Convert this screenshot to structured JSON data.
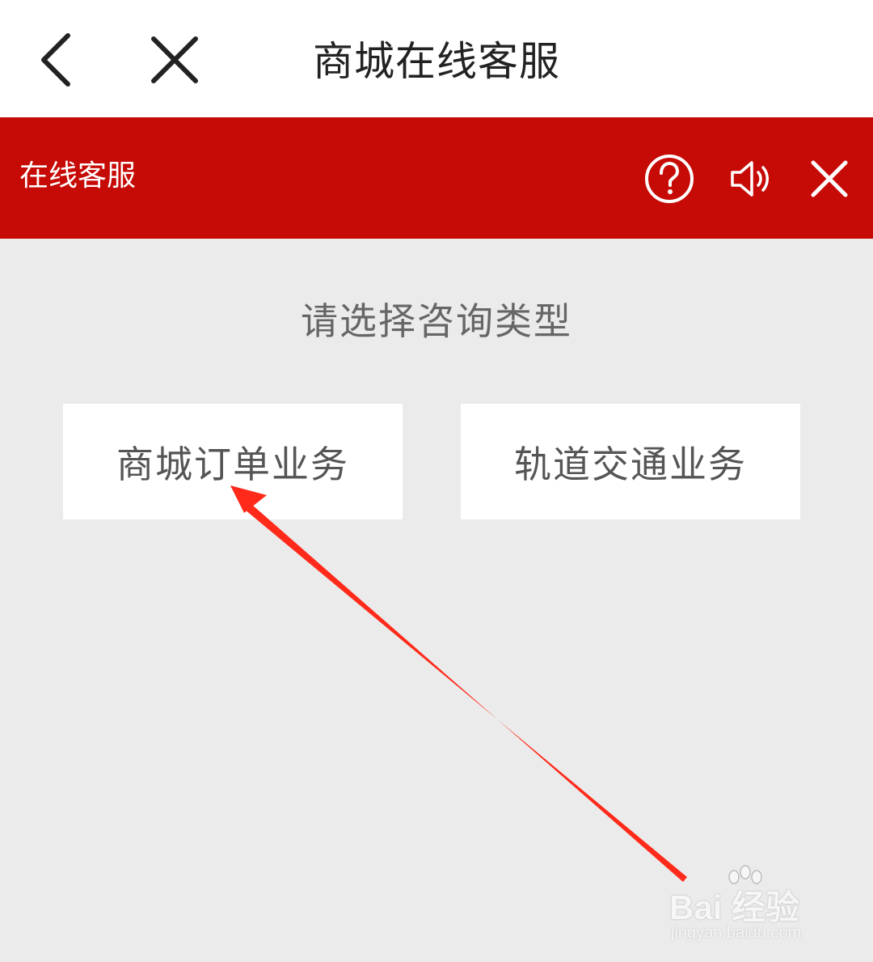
{
  "header": {
    "title": "商城在线客服",
    "back_icon": "back-arrow-icon",
    "close_icon": "close-icon"
  },
  "service_bar": {
    "label": "在线客服",
    "icons": [
      "help-icon",
      "sound-icon",
      "close-icon"
    ],
    "background_color": "#c60a05"
  },
  "main": {
    "prompt": "请选择咨询类型",
    "options": [
      {
        "label": "商城订单业务"
      },
      {
        "label": "轨道交通业务"
      }
    ]
  },
  "annotation": {
    "arrow_color": "#ff2a1a",
    "points_to": "商城订单业务"
  },
  "watermark": {
    "brand": "Bai 经验",
    "url": "jingyan.baidu.com"
  }
}
